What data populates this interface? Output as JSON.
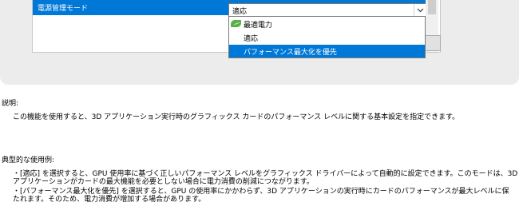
{
  "setting": {
    "label": "電源管理モード",
    "current_value": "適応"
  },
  "dropdown": {
    "options": [
      "最適電力",
      "適応",
      "パフォーマンス最大化を優先"
    ],
    "highlighted_index": 2
  },
  "description": {
    "heading": "説明:",
    "text": "この機能を使用すると、3D アプリケーション実行時のグラフィックス カードのパフォーマンス レベルに関する基本設定を指定できます。"
  },
  "examples": {
    "heading": "典型的な使用例:",
    "lines": [
      "・[適応] を選択すると、GPU 使用率に基づく正しいパフォーマンス レベルをグラフィックス ドライバーによって自動的に設定できます。このモードは、3D",
      "アプリケーションがカードの最大機能を必要としない場合に電力消費の削減につながります。",
      "・[パフォーマンス最大化を優先] を選択すると、GPU の使用率にかかわらず、3D アプリケーションの実行時にカードのパフォーマンスが最大レベルに保",
      "たれます。そのため、電力消費が増加する場合があります。"
    ]
  },
  "colors": {
    "selection": "#0078d7",
    "panel_bg": "#ececec",
    "leaf_icon": "#58b04a"
  }
}
